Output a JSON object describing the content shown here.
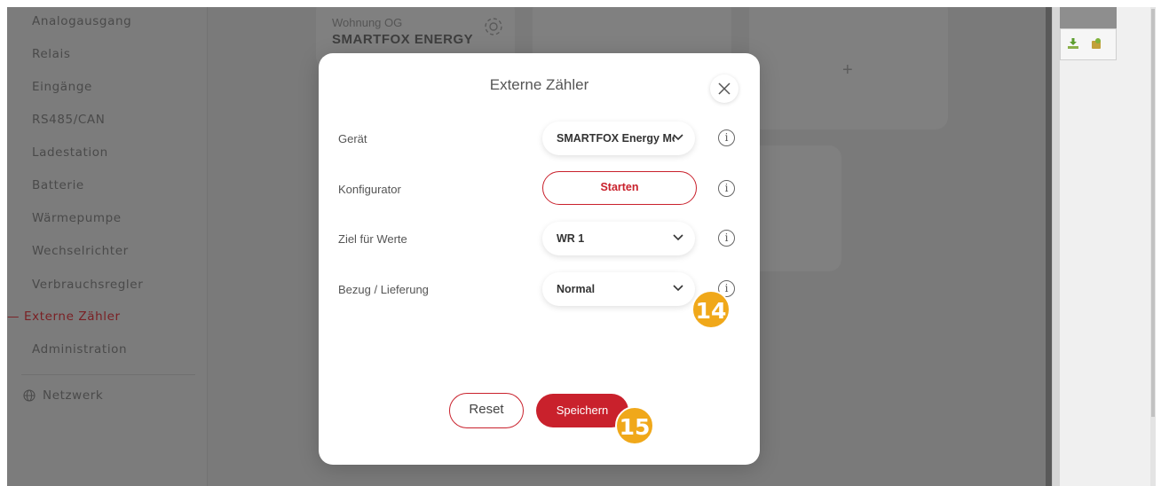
{
  "sidebar": {
    "items": [
      {
        "label": "Analogausgang"
      },
      {
        "label": "Relais"
      },
      {
        "label": "Eingänge"
      },
      {
        "label": "RS485/CAN"
      },
      {
        "label": "Ladestation"
      },
      {
        "label": "Batterie"
      },
      {
        "label": "Wärmepumpe"
      },
      {
        "label": "Wechselrichter"
      },
      {
        "label": "Verbrauchsregler"
      },
      {
        "label": "— Externe Zähler"
      },
      {
        "label": "Administration"
      }
    ],
    "network_label": "Netzwerk"
  },
  "background_card": {
    "subtitle": "Wohnung OG",
    "title": "SMARTFOX ENERGY",
    "add_symbol": "+"
  },
  "modal": {
    "title": "Externe Zähler",
    "rows": [
      {
        "label": "Gerät",
        "value": "SMARTFOX Energy Meter"
      },
      {
        "label": "Konfigurator",
        "button": "Starten"
      },
      {
        "label": "Ziel für Werte",
        "value": "WR 1"
      },
      {
        "label": "Bezug / Lieferung",
        "value": "Normal"
      }
    ],
    "info_symbol": "i",
    "reset_label": "Reset",
    "save_label": "Speichern"
  },
  "annotations": {
    "badge_14": "14",
    "badge_15": "15"
  },
  "colors": {
    "accent": "#c9212c",
    "badge": "#f0a81a",
    "overlay": "#7a7a7a"
  }
}
